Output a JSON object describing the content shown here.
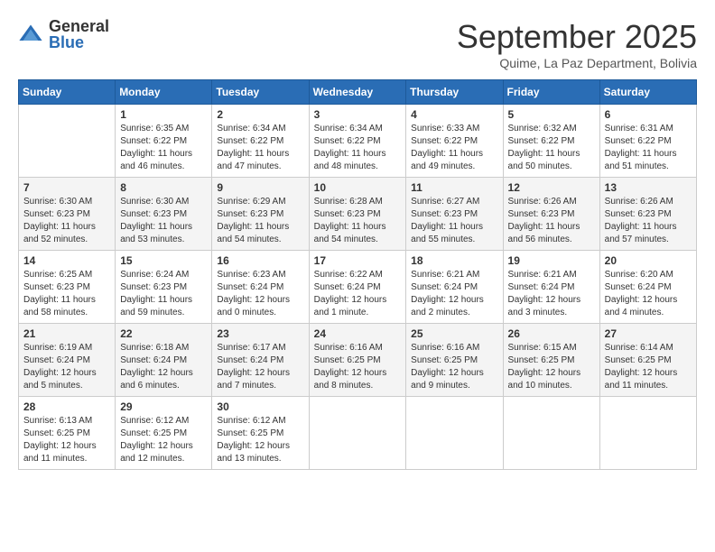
{
  "logo": {
    "general": "General",
    "blue": "Blue"
  },
  "header": {
    "month": "September 2025",
    "location": "Quime, La Paz Department, Bolivia"
  },
  "days_of_week": [
    "Sunday",
    "Monday",
    "Tuesday",
    "Wednesday",
    "Thursday",
    "Friday",
    "Saturday"
  ],
  "weeks": [
    [
      {
        "day": "",
        "info": ""
      },
      {
        "day": "1",
        "info": "Sunrise: 6:35 AM\nSunset: 6:22 PM\nDaylight: 11 hours\nand 46 minutes."
      },
      {
        "day": "2",
        "info": "Sunrise: 6:34 AM\nSunset: 6:22 PM\nDaylight: 11 hours\nand 47 minutes."
      },
      {
        "day": "3",
        "info": "Sunrise: 6:34 AM\nSunset: 6:22 PM\nDaylight: 11 hours\nand 48 minutes."
      },
      {
        "day": "4",
        "info": "Sunrise: 6:33 AM\nSunset: 6:22 PM\nDaylight: 11 hours\nand 49 minutes."
      },
      {
        "day": "5",
        "info": "Sunrise: 6:32 AM\nSunset: 6:22 PM\nDaylight: 11 hours\nand 50 minutes."
      },
      {
        "day": "6",
        "info": "Sunrise: 6:31 AM\nSunset: 6:22 PM\nDaylight: 11 hours\nand 51 minutes."
      }
    ],
    [
      {
        "day": "7",
        "info": "Sunrise: 6:30 AM\nSunset: 6:23 PM\nDaylight: 11 hours\nand 52 minutes."
      },
      {
        "day": "8",
        "info": "Sunrise: 6:30 AM\nSunset: 6:23 PM\nDaylight: 11 hours\nand 53 minutes."
      },
      {
        "day": "9",
        "info": "Sunrise: 6:29 AM\nSunset: 6:23 PM\nDaylight: 11 hours\nand 54 minutes."
      },
      {
        "day": "10",
        "info": "Sunrise: 6:28 AM\nSunset: 6:23 PM\nDaylight: 11 hours\nand 54 minutes."
      },
      {
        "day": "11",
        "info": "Sunrise: 6:27 AM\nSunset: 6:23 PM\nDaylight: 11 hours\nand 55 minutes."
      },
      {
        "day": "12",
        "info": "Sunrise: 6:26 AM\nSunset: 6:23 PM\nDaylight: 11 hours\nand 56 minutes."
      },
      {
        "day": "13",
        "info": "Sunrise: 6:26 AM\nSunset: 6:23 PM\nDaylight: 11 hours\nand 57 minutes."
      }
    ],
    [
      {
        "day": "14",
        "info": "Sunrise: 6:25 AM\nSunset: 6:23 PM\nDaylight: 11 hours\nand 58 minutes."
      },
      {
        "day": "15",
        "info": "Sunrise: 6:24 AM\nSunset: 6:23 PM\nDaylight: 11 hours\nand 59 minutes."
      },
      {
        "day": "16",
        "info": "Sunrise: 6:23 AM\nSunset: 6:24 PM\nDaylight: 12 hours\nand 0 minutes."
      },
      {
        "day": "17",
        "info": "Sunrise: 6:22 AM\nSunset: 6:24 PM\nDaylight: 12 hours\nand 1 minute."
      },
      {
        "day": "18",
        "info": "Sunrise: 6:21 AM\nSunset: 6:24 PM\nDaylight: 12 hours\nand 2 minutes."
      },
      {
        "day": "19",
        "info": "Sunrise: 6:21 AM\nSunset: 6:24 PM\nDaylight: 12 hours\nand 3 minutes."
      },
      {
        "day": "20",
        "info": "Sunrise: 6:20 AM\nSunset: 6:24 PM\nDaylight: 12 hours\nand 4 minutes."
      }
    ],
    [
      {
        "day": "21",
        "info": "Sunrise: 6:19 AM\nSunset: 6:24 PM\nDaylight: 12 hours\nand 5 minutes."
      },
      {
        "day": "22",
        "info": "Sunrise: 6:18 AM\nSunset: 6:24 PM\nDaylight: 12 hours\nand 6 minutes."
      },
      {
        "day": "23",
        "info": "Sunrise: 6:17 AM\nSunset: 6:24 PM\nDaylight: 12 hours\nand 7 minutes."
      },
      {
        "day": "24",
        "info": "Sunrise: 6:16 AM\nSunset: 6:25 PM\nDaylight: 12 hours\nand 8 minutes."
      },
      {
        "day": "25",
        "info": "Sunrise: 6:16 AM\nSunset: 6:25 PM\nDaylight: 12 hours\nand 9 minutes."
      },
      {
        "day": "26",
        "info": "Sunrise: 6:15 AM\nSunset: 6:25 PM\nDaylight: 12 hours\nand 10 minutes."
      },
      {
        "day": "27",
        "info": "Sunrise: 6:14 AM\nSunset: 6:25 PM\nDaylight: 12 hours\nand 11 minutes."
      }
    ],
    [
      {
        "day": "28",
        "info": "Sunrise: 6:13 AM\nSunset: 6:25 PM\nDaylight: 12 hours\nand 11 minutes."
      },
      {
        "day": "29",
        "info": "Sunrise: 6:12 AM\nSunset: 6:25 PM\nDaylight: 12 hours\nand 12 minutes."
      },
      {
        "day": "30",
        "info": "Sunrise: 6:12 AM\nSunset: 6:25 PM\nDaylight: 12 hours\nand 13 minutes."
      },
      {
        "day": "",
        "info": ""
      },
      {
        "day": "",
        "info": ""
      },
      {
        "day": "",
        "info": ""
      },
      {
        "day": "",
        "info": ""
      }
    ]
  ]
}
